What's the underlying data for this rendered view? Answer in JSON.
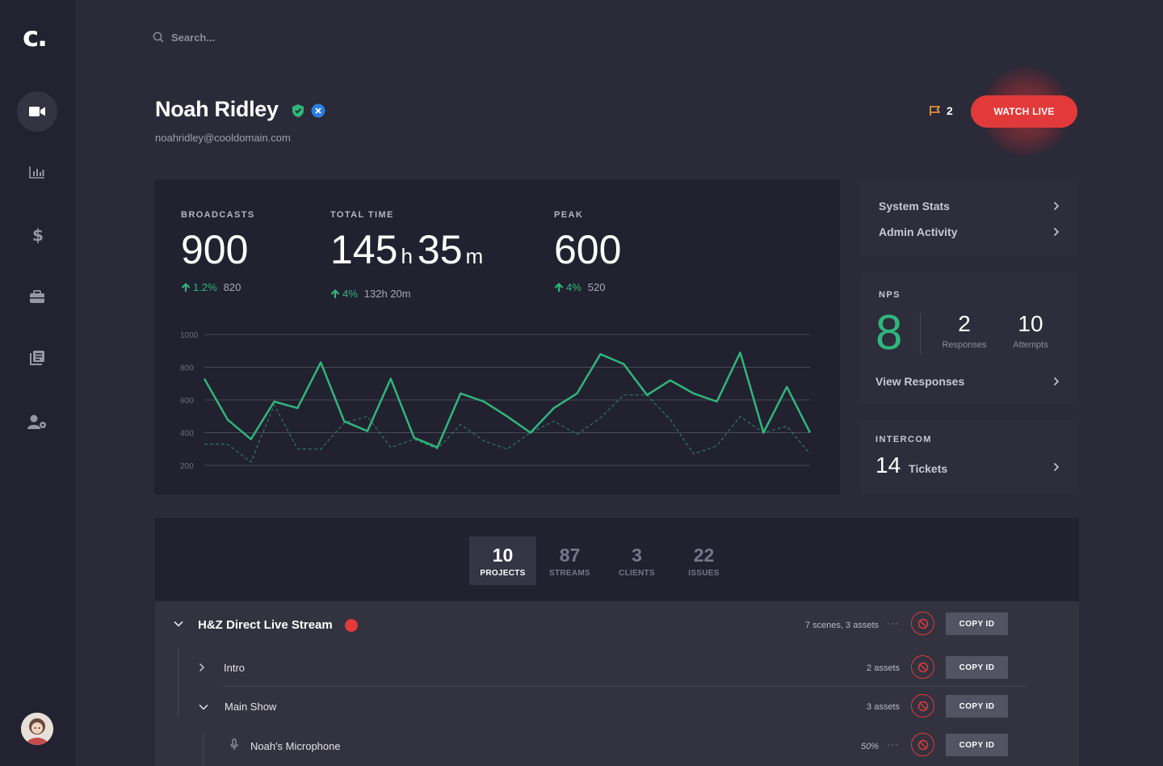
{
  "app": {
    "logo_text": "c."
  },
  "sidebar": {
    "items": [
      {
        "name": "video",
        "icon": "video-camera-icon",
        "active": true
      },
      {
        "name": "analytics",
        "icon": "bar-chart-icon",
        "active": false
      },
      {
        "name": "billing",
        "icon": "dollar-icon",
        "active": false
      },
      {
        "name": "projects",
        "icon": "briefcase-icon",
        "active": false
      },
      {
        "name": "library",
        "icon": "library-icon",
        "active": false
      },
      {
        "name": "users",
        "icon": "user-settings-icon",
        "active": false
      }
    ],
    "avatar": "user-avatar"
  },
  "search": {
    "placeholder": "Search..."
  },
  "profile": {
    "name": "Noah Ridley",
    "email": "noahridley@cooldomain.com",
    "badges": [
      "verified-shield-icon",
      "x-badge-icon"
    ]
  },
  "header": {
    "flag_count": "2",
    "watch_live_label": "WATCH LIVE"
  },
  "stats": {
    "broadcasts": {
      "label": "BROADCASTS",
      "value": "900",
      "delta": "1.2%",
      "previous": "820"
    },
    "total_time": {
      "label": "TOTAL TIME",
      "hours": "145",
      "hours_unit": "h",
      "minutes": "35",
      "minutes_unit": "m",
      "delta": "4%",
      "previous": "132h 20m"
    },
    "peak": {
      "label": "PEAK",
      "value": "600",
      "delta": "4%",
      "previous": "520"
    }
  },
  "chart_data": {
    "type": "line",
    "ylim": [
      200,
      1000
    ],
    "yticks": [
      1000,
      800,
      600,
      400,
      200
    ],
    "series": [
      {
        "style": "solid",
        "color": "#2fb67c",
        "values": [
          730,
          480,
          360,
          590,
          550,
          830,
          470,
          410,
          730,
          370,
          310,
          640,
          590,
          500,
          400,
          550,
          640,
          880,
          820,
          630,
          720,
          640,
          590,
          890,
          400,
          680,
          400
        ]
      },
      {
        "style": "dashed",
        "color": "#2f8a68",
        "values": [
          330,
          330,
          220,
          570,
          300,
          300,
          460,
          500,
          310,
          360,
          300,
          450,
          350,
          300,
          400,
          470,
          390,
          490,
          630,
          630,
          480,
          270,
          320,
          500,
          400,
          440,
          270
        ]
      }
    ]
  },
  "cards": {
    "links": [
      {
        "label": "System Stats"
      },
      {
        "label": "Admin Activity"
      }
    ],
    "nps": {
      "title": "NPS",
      "score": "8",
      "responses": {
        "value": "2",
        "label": "Responses"
      },
      "attempts": {
        "value": "10",
        "label": "Attempts"
      },
      "link": "View Responses"
    },
    "intercom": {
      "title": "INTERCOM",
      "count": "14",
      "label": "Tickets"
    }
  },
  "tabs": [
    {
      "count": "10",
      "label": "PROJECTS",
      "active": true
    },
    {
      "count": "87",
      "label": "STREAMS",
      "active": false
    },
    {
      "count": "3",
      "label": "CLIENTS",
      "active": false
    },
    {
      "count": "22",
      "label": "ISSUES",
      "active": false
    }
  ],
  "project_list": {
    "rows": [
      {
        "name": "H&Z Direct Live Stream",
        "meta": "7 scenes, 3 assets",
        "copy_label": "COPY ID",
        "live": true
      },
      {
        "name": "Intro",
        "meta": "2 assets",
        "copy_label": "COPY ID"
      },
      {
        "name": "Main Show",
        "meta": "3 assets",
        "copy_label": "COPY ID"
      },
      {
        "name": "Noah's Microphone",
        "meta": "50%",
        "copy_label": "COPY ID"
      }
    ]
  },
  "colors": {
    "accent_green": "#2fb67c",
    "danger_red": "#e23a3a",
    "bg": "#2b2a38",
    "panel": "#222130"
  }
}
